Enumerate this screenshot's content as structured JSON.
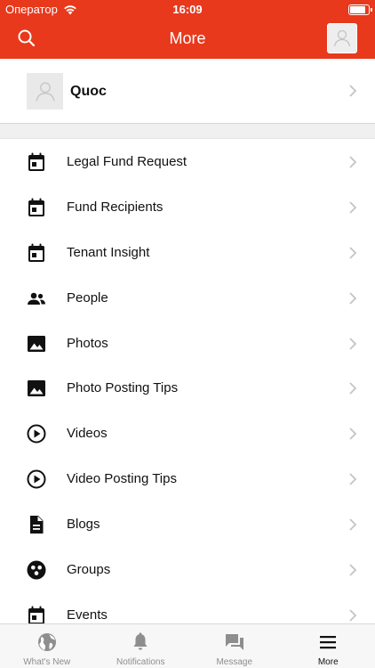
{
  "status_bar": {
    "carrier": "Оператор",
    "time": "16:09",
    "battery_level": 0.9,
    "wifi_icon": "wifi-icon"
  },
  "nav": {
    "title": "More",
    "search_icon": "search-icon",
    "avatar_icon": "user-avatar-icon"
  },
  "profile": {
    "name": "Quoc",
    "avatar_icon": "user-avatar-icon"
  },
  "menu": {
    "items": [
      {
        "label": "Legal Fund Request",
        "icon": "calendar-icon"
      },
      {
        "label": "Fund Recipients",
        "icon": "calendar-icon"
      },
      {
        "label": "Tenant Insight",
        "icon": "calendar-icon"
      },
      {
        "label": "People",
        "icon": "people-icon"
      },
      {
        "label": "Photos",
        "icon": "photo-icon"
      },
      {
        "label": "Photo Posting Tips",
        "icon": "photo-icon"
      },
      {
        "label": "Videos",
        "icon": "play-circle-icon"
      },
      {
        "label": "Video Posting Tips",
        "icon": "play-circle-icon"
      },
      {
        "label": "Blogs",
        "icon": "document-icon"
      },
      {
        "label": "Groups",
        "icon": "groups-icon"
      },
      {
        "label": "Events",
        "icon": "calendar-icon"
      }
    ]
  },
  "tabs": [
    {
      "label": "What's New",
      "icon": "globe-icon",
      "active": false
    },
    {
      "label": "Notifications",
      "icon": "bell-icon",
      "active": false
    },
    {
      "label": "Message",
      "icon": "chat-icon",
      "active": false
    },
    {
      "label": "More",
      "icon": "menu-icon",
      "active": true
    }
  ],
  "colors": {
    "brand": "#e8391d",
    "tab_inactive": "#8e8e8e",
    "tab_active": "#111111"
  }
}
